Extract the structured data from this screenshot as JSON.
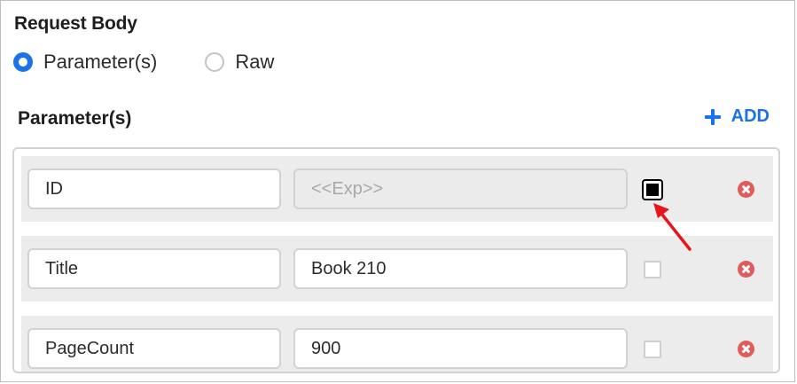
{
  "request_body": {
    "title": "Request Body",
    "options": [
      {
        "label": "Parameter(s)",
        "checked": true
      },
      {
        "label": "Raw",
        "checked": false
      }
    ]
  },
  "parameters": {
    "header": "Parameter(s)",
    "add_label": "ADD",
    "rows": [
      {
        "name": "ID",
        "value": "",
        "value_placeholder": "<<Exp>>",
        "value_disabled": true,
        "checked": true
      },
      {
        "name": "Title",
        "value": "Book 210",
        "value_placeholder": "",
        "value_disabled": false,
        "checked": false
      },
      {
        "name": "PageCount",
        "value": "900",
        "value_placeholder": "",
        "value_disabled": false,
        "checked": false
      }
    ]
  },
  "icons": {
    "add": "plus-icon",
    "remove": "remove-circle-icon",
    "annotation": "red-arrow-icon"
  },
  "colors": {
    "accent": "#1a73e8",
    "remove": "#e05b5b",
    "annotation_arrow": "#e8141c",
    "row_background": "#ececec"
  }
}
